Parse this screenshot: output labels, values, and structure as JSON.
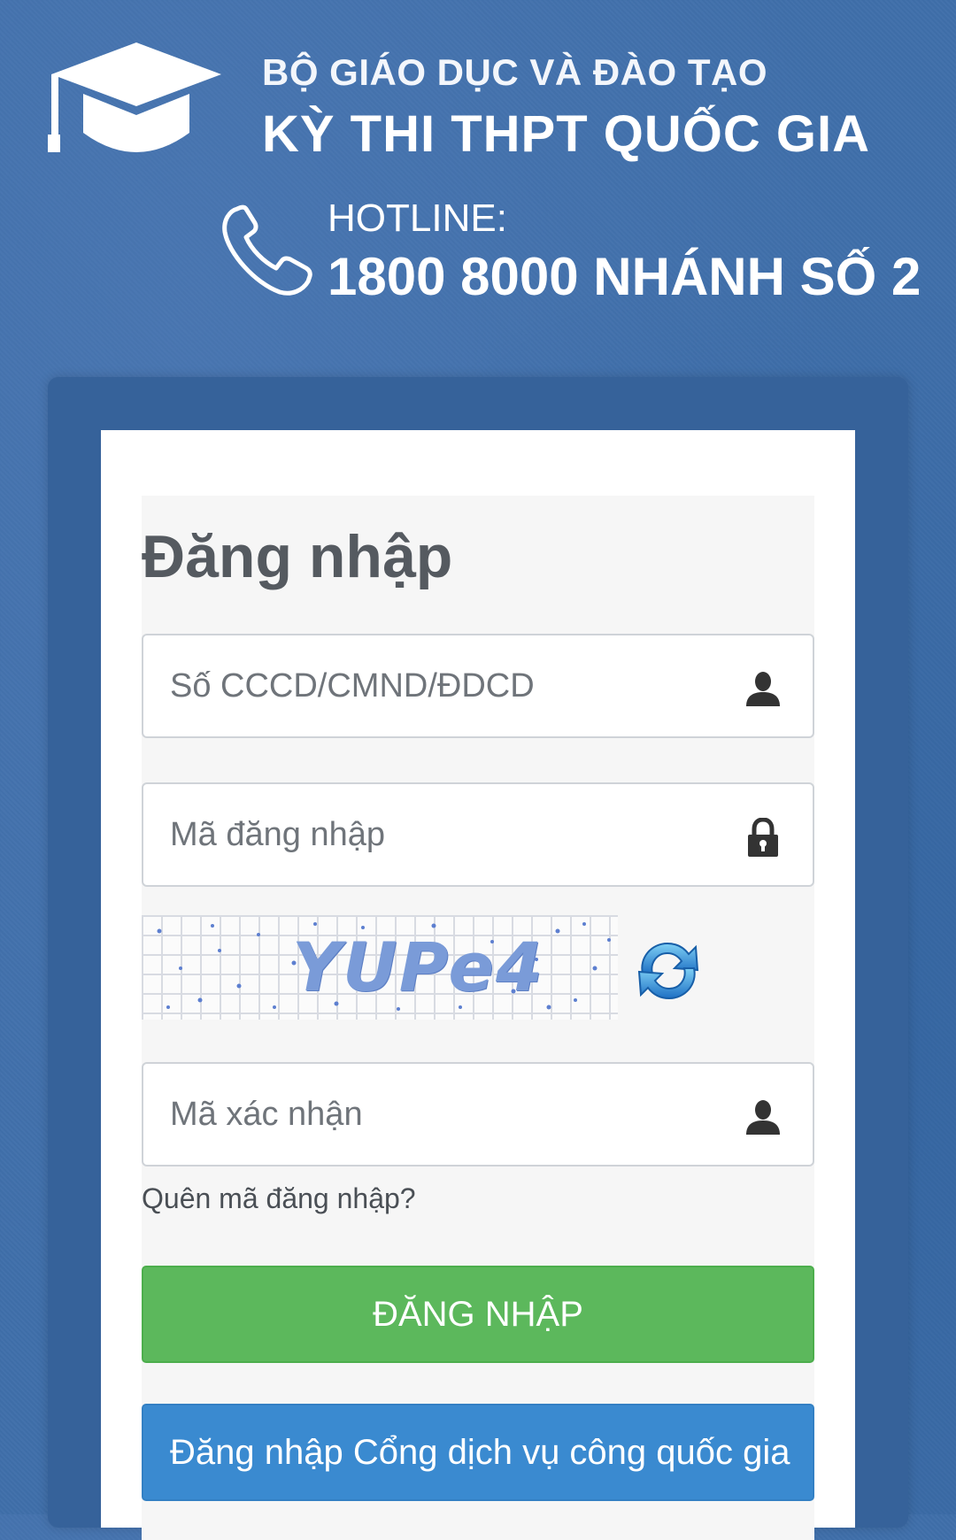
{
  "header": {
    "organization": "BỘ GIÁO DỤC VÀ ĐÀO TẠO",
    "exam_name": "KỲ THI THPT QUỐC GIA",
    "hotline_label": "HOTLINE:",
    "hotline_number": "1800 8000 NHÁNH SỐ 2",
    "logo_icon": "graduation-cap-icon",
    "phone_icon": "phone-icon"
  },
  "login": {
    "title": "Đăng nhập",
    "id_field": {
      "placeholder": "Số CCCD/CMND/ĐDCD",
      "value": "",
      "icon": "user-icon"
    },
    "code_field": {
      "placeholder": "Mã đăng nhập",
      "value": "",
      "icon": "lock-icon"
    },
    "captcha": {
      "text": "YUPe4",
      "refresh_icon": "refresh-icon"
    },
    "captcha_field": {
      "placeholder": "Mã xác nhận",
      "value": "",
      "icon": "user-icon"
    },
    "forgot_link": "Quên mã đăng nhập?",
    "submit_label": "ĐĂNG NHẬP",
    "national_portal_label": "Đăng nhập Cổng dịch vụ công quốc gia"
  },
  "colors": {
    "background": "#3f6faa",
    "frame": "#36629a",
    "login_button": "#5cb85c",
    "portal_button": "#3a8ad0",
    "title_text": "#555a60"
  }
}
